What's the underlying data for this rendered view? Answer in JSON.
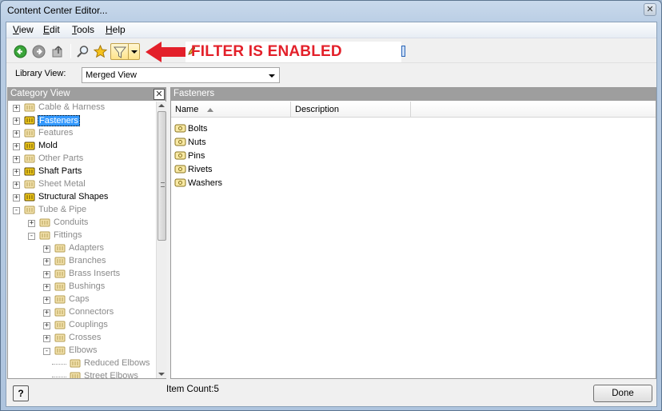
{
  "window": {
    "title": "Content Center Editor...",
    "close_glyph": "✕"
  },
  "menubar": {
    "items": [
      {
        "label_u": "V",
        "label_rest": "iew"
      },
      {
        "label_u": "E",
        "label_rest": "dit"
      },
      {
        "label_u": "T",
        "label_rest": "ools"
      },
      {
        "label_u": "H",
        "label_rest": "elp"
      }
    ]
  },
  "toolbar": {
    "back_icon": "back-arrow-icon",
    "forward_icon": "forward-arrow-icon",
    "up_icon": "up-folder-icon",
    "search_icon": "search-icon",
    "favorite_icon": "star-icon",
    "filter_icon": "filter-icon",
    "pending_icon": "pencil-icon"
  },
  "annotation": {
    "text": "FILTER IS ENABLED",
    "color": "#e3202a"
  },
  "library": {
    "label": "Library View:",
    "selected": "Merged View"
  },
  "category_view": {
    "header": "Category View",
    "close_glyph": "✕",
    "tree": [
      {
        "label": "Cable & Harness",
        "level": 0,
        "expander": "+",
        "dim": true
      },
      {
        "label": "Fasteners",
        "level": 0,
        "expander": "+",
        "selected": true
      },
      {
        "label": "Features",
        "level": 0,
        "expander": "+",
        "dim": true
      },
      {
        "label": "Mold",
        "level": 0,
        "expander": "+"
      },
      {
        "label": "Other Parts",
        "level": 0,
        "expander": "+",
        "dim": true
      },
      {
        "label": "Shaft Parts",
        "level": 0,
        "expander": "+"
      },
      {
        "label": "Sheet Metal",
        "level": 0,
        "expander": "+",
        "dim": true
      },
      {
        "label": "Structural Shapes",
        "level": 0,
        "expander": "+"
      },
      {
        "label": "Tube & Pipe",
        "level": 0,
        "expander": "−",
        "dim": true
      },
      {
        "label": "Conduits",
        "level": 1,
        "expander": "+",
        "dim": true
      },
      {
        "label": "Fittings",
        "level": 1,
        "expander": "−",
        "dim": true
      },
      {
        "label": "Adapters",
        "level": 2,
        "expander": "+",
        "dim": true
      },
      {
        "label": "Branches",
        "level": 2,
        "expander": "+",
        "dim": true
      },
      {
        "label": "Brass Inserts",
        "level": 2,
        "expander": "+",
        "dim": true
      },
      {
        "label": "Bushings",
        "level": 2,
        "expander": "+",
        "dim": true
      },
      {
        "label": "Caps",
        "level": 2,
        "expander": "+",
        "dim": true
      },
      {
        "label": "Connectors",
        "level": 2,
        "expander": "+",
        "dim": true
      },
      {
        "label": "Couplings",
        "level": 2,
        "expander": "+",
        "dim": true
      },
      {
        "label": "Crosses",
        "level": 2,
        "expander": "+",
        "dim": true
      },
      {
        "label": "Elbows",
        "level": 2,
        "expander": "−",
        "dim": true
      },
      {
        "label": "Reduced Elbows",
        "level": 3,
        "expander": "",
        "dim": true
      },
      {
        "label": "Street Elbows",
        "level": 3,
        "expander": "",
        "dim": true
      }
    ]
  },
  "content": {
    "header": "Fasteners",
    "columns": [
      "Name",
      "Description"
    ],
    "items": [
      "Bolts",
      "Nuts",
      "Pins",
      "Rivets",
      "Washers"
    ]
  },
  "status": {
    "item_count": "Item Count:5",
    "help_label": "?",
    "done_label": "Done"
  }
}
